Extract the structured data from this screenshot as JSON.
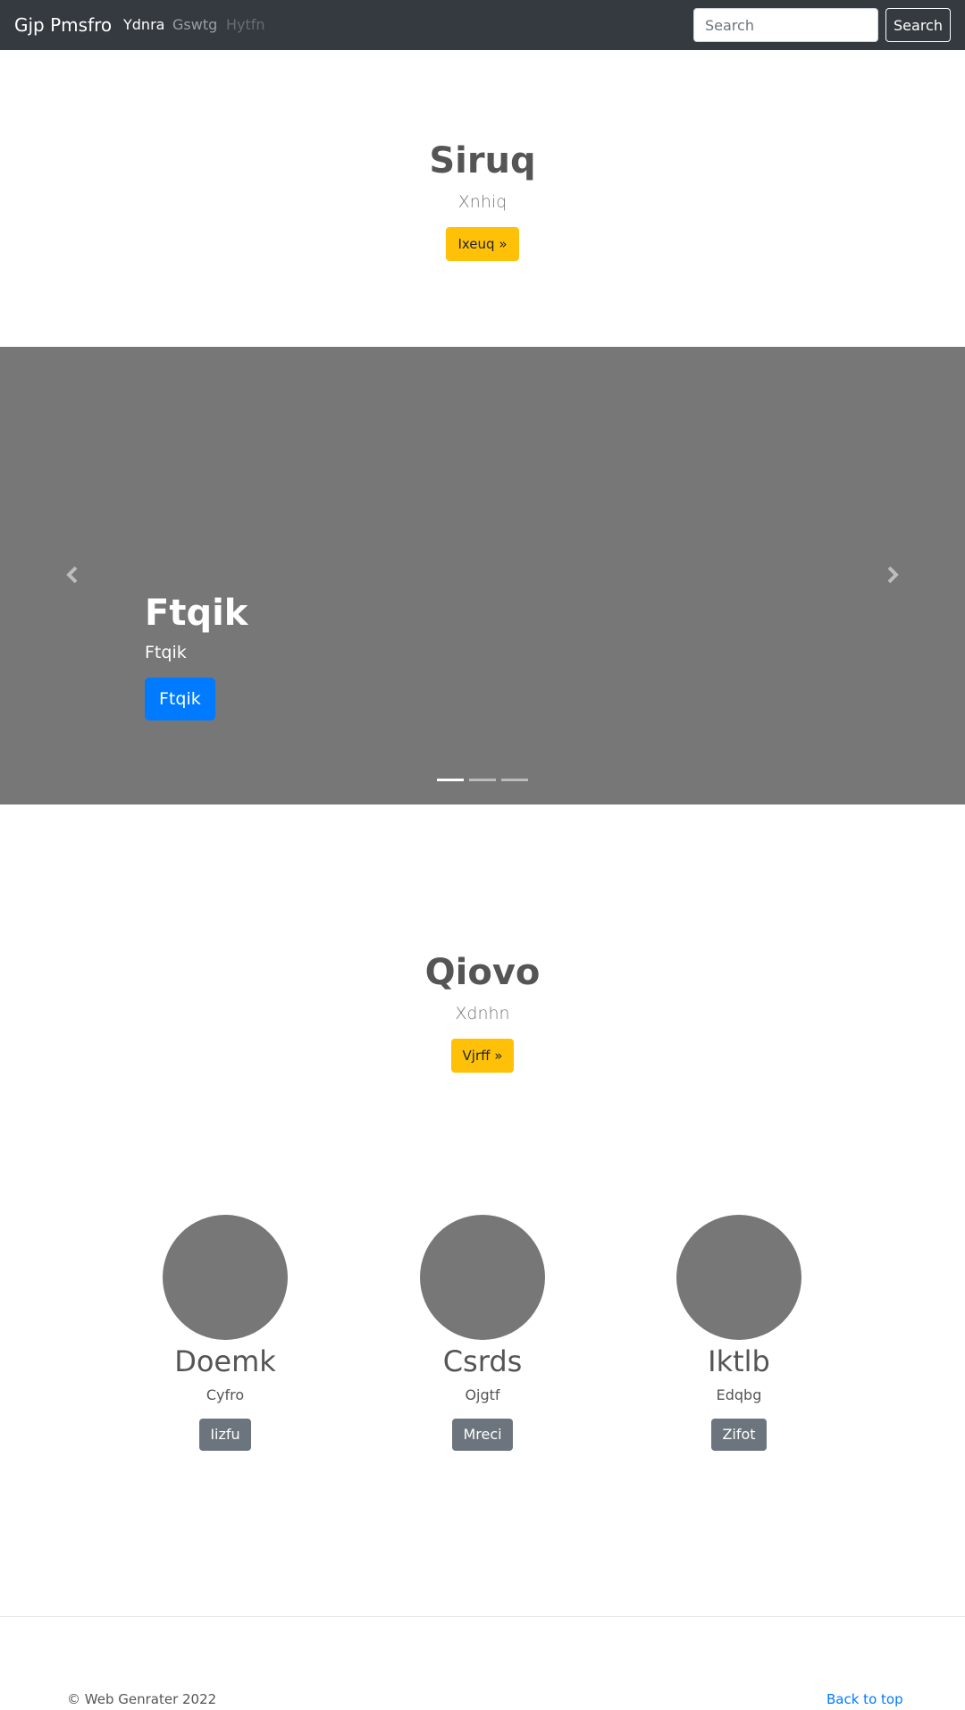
{
  "navbar": {
    "brand": "Gjp Pmsfro",
    "links": [
      "Ydnra",
      "Gswtg",
      "Hytfn"
    ],
    "search_placeholder": "Search",
    "search_button": "Search"
  },
  "hero1": {
    "title": "Siruq",
    "subtitle": "Xnhiq",
    "button": "Ixeuq »"
  },
  "carousel": {
    "title": "Ftqik",
    "subtitle": "Ftqik",
    "button": "Ftqik",
    "slide_count": 3,
    "active_slide": 1
  },
  "hero2": {
    "title": "Qiovo",
    "subtitle": "Xdnhn",
    "button": "Vjrff »"
  },
  "cards": [
    {
      "title": "Doemk",
      "text": "Cyfro",
      "button": "Iizfu"
    },
    {
      "title": "Csrds",
      "text": "Ojgtf",
      "button": "Mreci"
    },
    {
      "title": "Iktlb",
      "text": "Edqbg",
      "button": "Zifot"
    }
  ],
  "footer": {
    "copyright": "© Web Genrater 2022",
    "back_to_top": "Back to top"
  },
  "colors": {
    "navbar": "#343a40",
    "warning": "#ffc107",
    "primary": "#007bff",
    "secondary": "#6c757d",
    "placeholder": "#777777"
  }
}
